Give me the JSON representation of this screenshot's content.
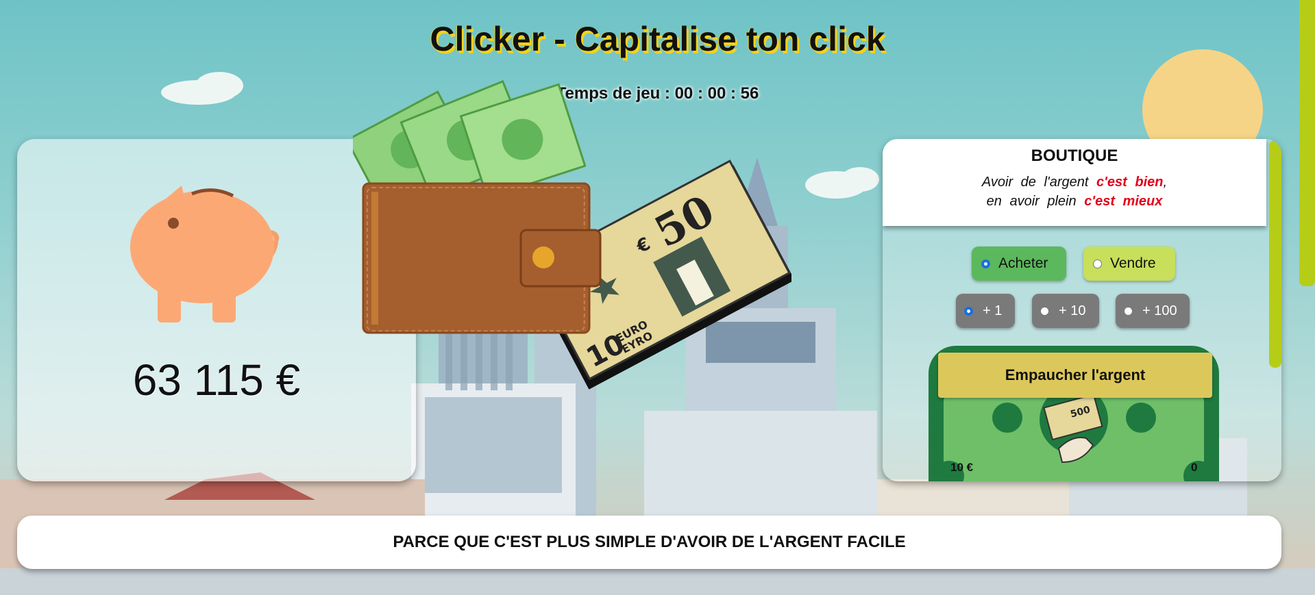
{
  "header": {
    "title": "Clicker - Capitalise ton click",
    "timer": "Temps de jeu : 00 : 00 : 56"
  },
  "bank": {
    "amount": "63 115 €"
  },
  "shop": {
    "title": "BOUTIQUE",
    "motto_line1_prefix": "Avoir de l'argent",
    "motto_line1_emphasis": "c'est bien",
    "motto_line1_suffix": ",",
    "motto_line2_prefix": "en avoir plein",
    "motto_line2_emphasis": "c'est mieux",
    "mode": {
      "buy_label": "Acheter",
      "sell_label": "Vendre",
      "selected": "Acheter"
    },
    "quantity": {
      "options": [
        "+ 1",
        "+ 10",
        "+ 100"
      ],
      "selected": "+ 1"
    },
    "item": {
      "button_label": "Empaucher l'argent",
      "price": "10 €",
      "owned": "0"
    }
  },
  "footer": {
    "slogan": "PARCE QUE C'EST PLUS SIMPLE D'AVOIR DE L'ARGENT FACILE"
  },
  "colors": {
    "title_shadow": "#f2d21a",
    "buy_button": "#5cb85c",
    "sell_button": "#c7df5a",
    "scrollbar": "#b6cd17",
    "emphasis_red": "#e3001b",
    "note_green": "#1f7a3f"
  },
  "icons": [
    "piggy-bank-icon",
    "wallet-icon",
    "banknote-50-euro-icon",
    "cash-stack-icon",
    "hand-with-banknote-icon"
  ]
}
